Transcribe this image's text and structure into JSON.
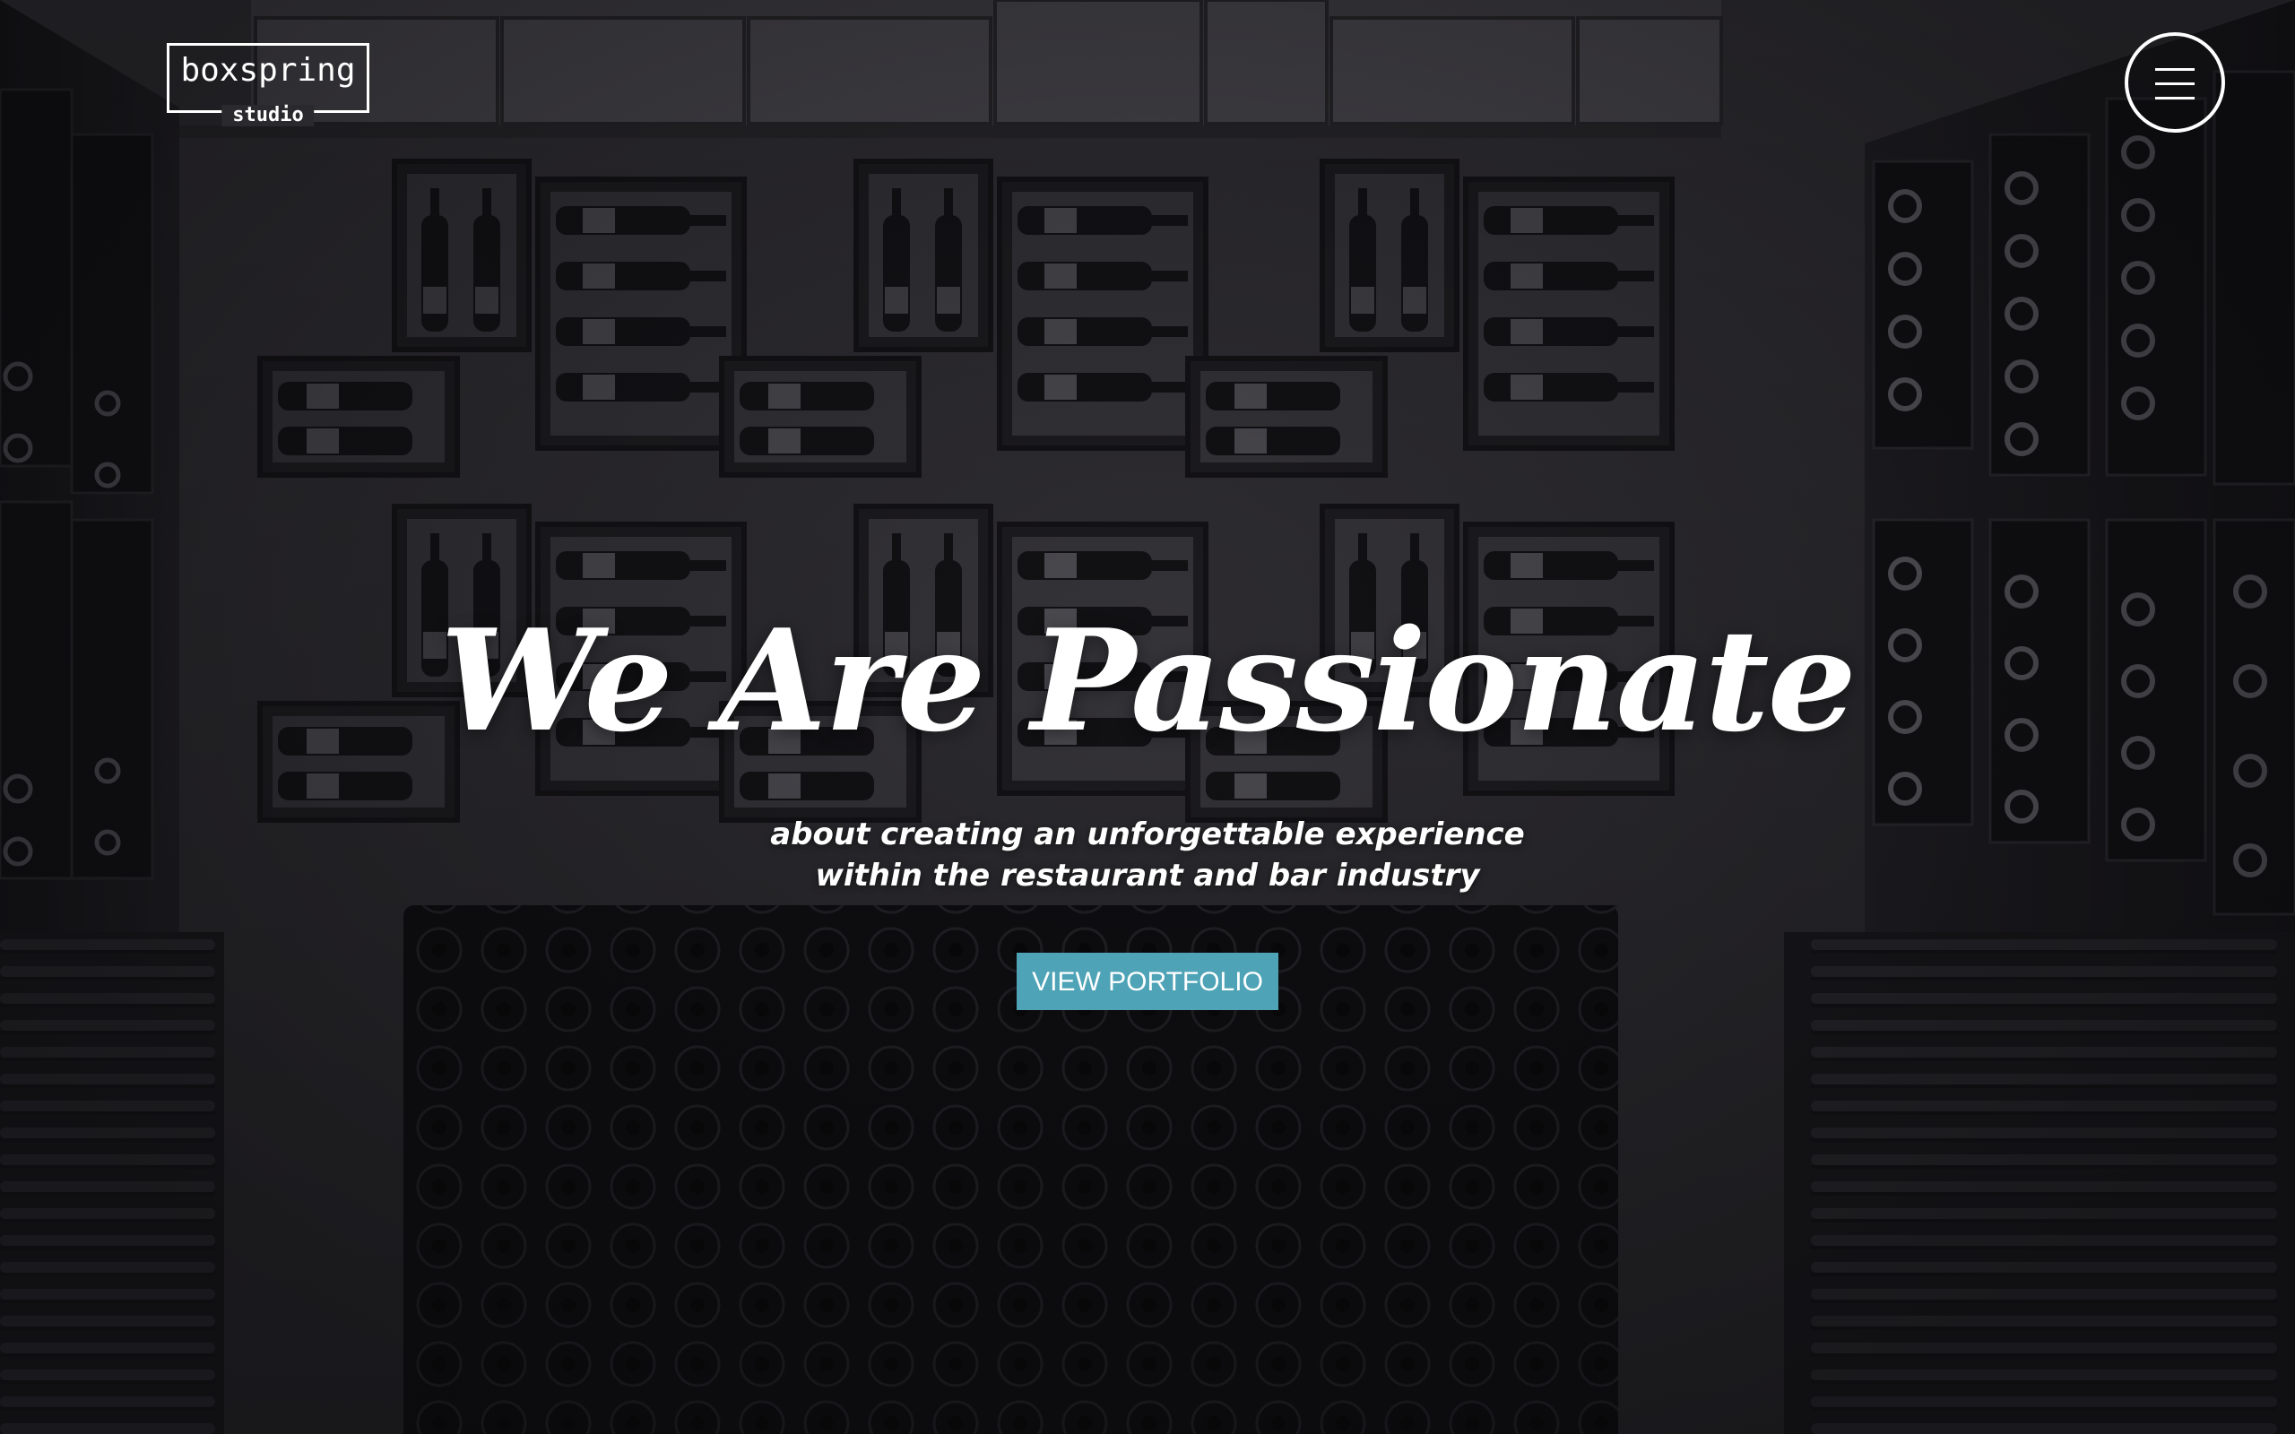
{
  "brand": {
    "logo_word": "boxspring",
    "logo_sub": "studio"
  },
  "nav": {
    "menu_icon": "hamburger-menu-icon"
  },
  "hero": {
    "title": "We Are Passionate",
    "subtitle_line1": "about creating an unforgettable experience",
    "subtitle_line2": "within the restaurant and bar industry",
    "cta_label": "VIEW PORTFOLIO"
  },
  "colors": {
    "accent": "#4ea3b7",
    "text": "#ffffff",
    "background": "#201f23"
  }
}
